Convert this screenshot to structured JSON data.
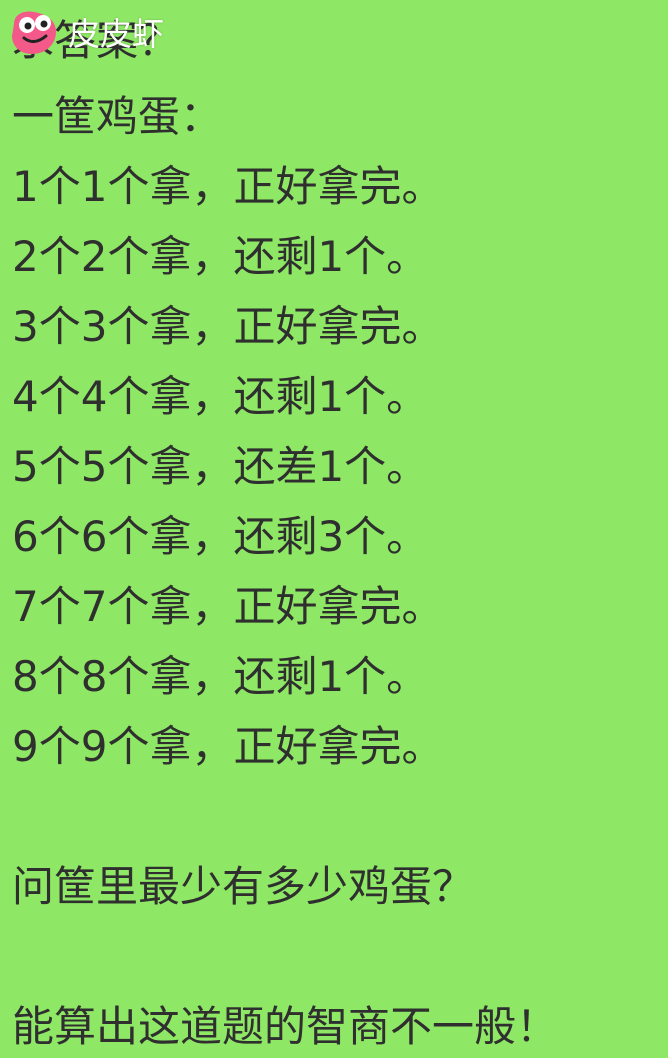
{
  "watermark": {
    "text": "皮皮虾",
    "icon": "shrimp-mascot-icon"
  },
  "content": {
    "line_0": "求答案？",
    "line_1": "一筐鸡蛋：",
    "line_2": "1个1个拿，正好拿完。",
    "line_3": "2个2个拿，还剩1个。",
    "line_4": "3个3个拿，正好拿完。",
    "line_5": "4个4个拿，还剩1个。",
    "line_6": "5个5个拿，还差1个。",
    "line_7": "6个6个拿，还剩3个。",
    "line_8": "7个7个拿，正好拿完。",
    "line_9": "8个8个拿，还剩1个。",
    "line_10": "9个9个拿，正好拿完。",
    "question": "问筐里最少有多少鸡蛋？",
    "closing": "能算出这道题的智商不一般！"
  },
  "colors": {
    "background": "#8fe865",
    "text": "#2f2f2f",
    "logo_pink": "#f35a8a",
    "watermark_text": "#ffffff"
  }
}
